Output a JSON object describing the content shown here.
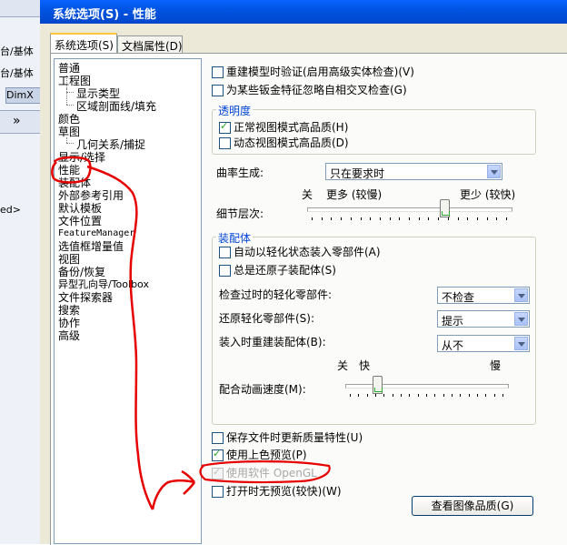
{
  "background_app": {
    "line1": "台/基体",
    "line2": "台/基体",
    "tab_label": "DimX",
    "chevron": "»",
    "snippet": "ed>"
  },
  "window": {
    "title": "系统选项(S) - 性能"
  },
  "tabs": [
    {
      "label": "系统选项(S)",
      "active": true
    },
    {
      "label": "文档属性(D)",
      "active": false
    }
  ],
  "tree": [
    {
      "label": "普通"
    },
    {
      "label": "工程图"
    },
    {
      "label": "显示类型"
    },
    {
      "label": "区域剖面线/填充"
    },
    {
      "label": "颜色"
    },
    {
      "label": "草图"
    },
    {
      "label": "几何关系/捕捉"
    },
    {
      "label": "显示/选择"
    },
    {
      "label": "性能",
      "selected": true
    },
    {
      "label": "装配体"
    },
    {
      "label": "外部参考引用"
    },
    {
      "label": "默认模板"
    },
    {
      "label": "文件位置"
    },
    {
      "label": "FeatureManager"
    },
    {
      "label": "选值框增量值"
    },
    {
      "label": "视图"
    },
    {
      "label": "备份/恢复"
    },
    {
      "label": "异型孔向导/Toolbox"
    },
    {
      "label": "文件探索器"
    },
    {
      "label": "搜索"
    },
    {
      "label": "协作"
    },
    {
      "label": "高级"
    }
  ],
  "options": {
    "rebuild_verify": {
      "label": "重建模型时验证(启用高级实体检查)(V)",
      "checked": false
    },
    "ignore_sheetmetal": {
      "label": "为某些钣金特征忽略自相交叉检查(G)",
      "checked": false
    }
  },
  "transparency": {
    "title": "透明度",
    "high_quality_normal": {
      "label": "正常视图模式高品质(H)",
      "checked": true
    },
    "high_quality_dynamic": {
      "label": "动态视图模式高品质(D)",
      "checked": false
    }
  },
  "curvature": {
    "label": "曲率生成:",
    "value": "只在要求时"
  },
  "level_of_detail": {
    "label": "细节层次:",
    "left_label": "关",
    "more_label": "更多 (较慢)",
    "less_label": "更少 (较快)",
    "value_fraction": 0.68
  },
  "assemblies": {
    "title": "装配体",
    "auto_lightweight": {
      "label": "自动以轻化状态装入零部件(A)",
      "checked": false
    },
    "always_resolve": {
      "label": "总是还原子装配体(S)",
      "checked": false
    },
    "check_outofdate": {
      "label": "检查过时的轻化零部件:",
      "value": "不检查"
    },
    "resolve_lightweight": {
      "label": "还原轻化零部件(S):",
      "value": "提示"
    },
    "rebuild_on_load": {
      "label": "装入时重建装配体(B):",
      "value": "从不"
    },
    "mate_animation": {
      "label": "配合动画速度(M):",
      "off_label": "关",
      "fast_label": "快",
      "slow_label": "慢",
      "value_fraction": 0.18
    }
  },
  "bottom_options": {
    "save_mass_props": {
      "label": "保存文件时更新质量特性(U)",
      "checked": false
    },
    "shaded_preview": {
      "label": "使用上色预览(P)",
      "checked": true
    },
    "software_opengl": {
      "label": "使用软件 OpenGL",
      "checked": true,
      "disabled": true
    },
    "no_preview": {
      "label": "打开时无预览(较快)(W)",
      "checked": false
    }
  },
  "buttons": {
    "image_quality": "查看图像品质(G)"
  },
  "colors": {
    "title_bar": "#0054e3",
    "group_title": "#0046d5",
    "annotation": "#e60000"
  }
}
